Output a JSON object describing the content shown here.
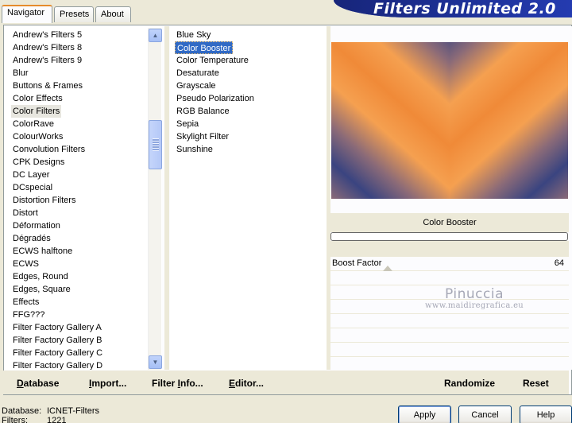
{
  "banner": {
    "title": "Filters Unlimited 2.0"
  },
  "tabs": [
    {
      "label": "Navigator"
    },
    {
      "label": "Presets"
    },
    {
      "label": "About"
    }
  ],
  "categories": [
    "Andrew's Filters 5",
    "Andrew's Filters 8",
    "Andrew's Filters 9",
    "Blur",
    "Buttons & Frames",
    "Color Effects",
    "Color Filters",
    "ColorRave",
    "ColourWorks",
    "Convolution Filters",
    "CPK Designs",
    "DC Layer",
    "DCspecial",
    "Distortion Filters",
    "Distort",
    "Déformation",
    "Dégradés",
    "ECWS halftone",
    "ECWS",
    "Edges, Round",
    "Edges, Square",
    "Effects",
    "FFG???",
    "Filter Factory Gallery A",
    "Filter Factory Gallery B",
    "Filter Factory Gallery C",
    "Filter Factory Gallery D"
  ],
  "selected_category": "Color Filters",
  "filters": [
    "Blue Sky",
    "Color Booster",
    "Color Temperature",
    "Desaturate",
    "Grayscale",
    "Pseudo Polarization",
    "RGB Balance",
    "Sepia",
    "Skylight Filter",
    "Sunshine"
  ],
  "selected_filter": "Color Booster",
  "preview": {
    "filter_name": "Color Booster",
    "colors": {
      "orange": "#f08a38",
      "navy": "#3a4480"
    }
  },
  "params": [
    {
      "label": "Boost Factor",
      "value": "64"
    }
  ],
  "watermark": {
    "line1": "Pinuccia",
    "line2": "www.maidiregrafica.eu"
  },
  "toolbar": {
    "database": {
      "u": "D",
      "rest": "atabase"
    },
    "import": {
      "u": "I",
      "rest": "mport..."
    },
    "filter_info": {
      "pre": "Filter ",
      "u": "I",
      "rest": "nfo..."
    },
    "editor": {
      "u": "E",
      "rest": "ditor..."
    },
    "randomize": "Randomize",
    "reset": "Reset"
  },
  "status": [
    {
      "key": "Database:",
      "value": "ICNET-Filters"
    },
    {
      "key": "Filters:",
      "value": "1221"
    }
  ],
  "buttons": {
    "apply": "Apply",
    "cancel": "Cancel",
    "help": "Help"
  }
}
